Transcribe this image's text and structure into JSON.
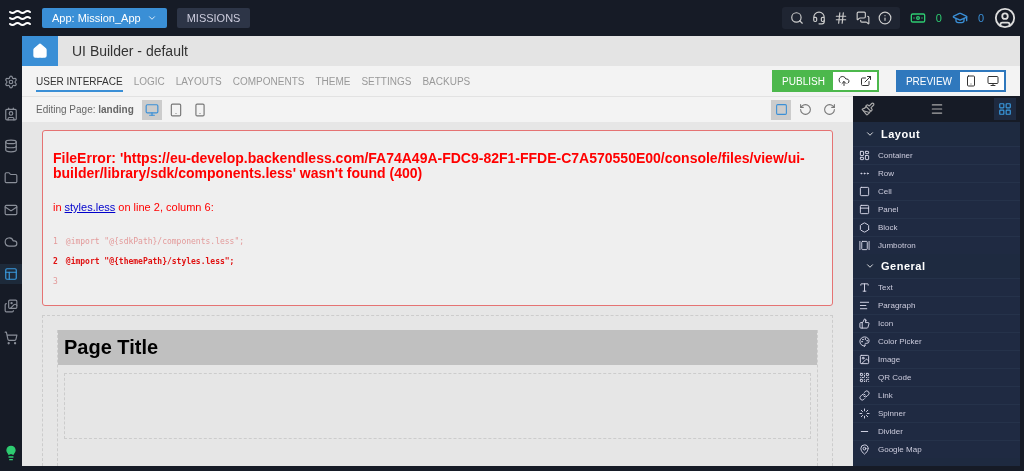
{
  "topbar": {
    "app_button": "App: Mission_App",
    "missions_button": "MISSIONS",
    "money_count": "0",
    "education_count": "0"
  },
  "rail": [
    {
      "kind": "settings",
      "selected": false
    },
    {
      "kind": "users",
      "selected": false
    },
    {
      "kind": "database",
      "selected": false
    },
    {
      "kind": "files",
      "selected": false
    },
    {
      "kind": "messaging",
      "selected": false
    },
    {
      "kind": "cloud",
      "selected": false
    },
    {
      "kind": "ui",
      "selected": true
    },
    {
      "kind": "media",
      "selected": false
    },
    {
      "kind": "market",
      "selected": false
    }
  ],
  "header": {
    "title": "UI Builder - default"
  },
  "tabs": [
    {
      "label": "USER INTERFACE",
      "selected": true
    },
    {
      "label": "LOGIC",
      "selected": false
    },
    {
      "label": "LAYOUTS",
      "selected": false
    },
    {
      "label": "COMPONENTS",
      "selected": false
    },
    {
      "label": "THEME",
      "selected": false
    },
    {
      "label": "SETTINGS",
      "selected": false
    },
    {
      "label": "BACKUPS",
      "selected": false
    }
  ],
  "publish_button": "PUBLISH",
  "preview_button": "PREVIEW",
  "editing": {
    "label": "Editing Page:",
    "page": "landing",
    "devices": [
      {
        "kind": "desktop",
        "selected": true
      },
      {
        "kind": "tablet",
        "selected": false
      },
      {
        "kind": "phone",
        "selected": false
      }
    ],
    "outline_selected": true
  },
  "panel_tabs": [
    {
      "kind": "style",
      "selected": false
    },
    {
      "kind": "tree",
      "selected": false
    },
    {
      "kind": "components",
      "selected": true
    }
  ],
  "sections": [
    {
      "title": "Layout",
      "expanded": true,
      "items": [
        {
          "label": "Container",
          "kind": "container"
        },
        {
          "label": "Row",
          "kind": "row"
        },
        {
          "label": "Cell",
          "kind": "cell"
        },
        {
          "label": "Panel",
          "kind": "panel"
        },
        {
          "label": "Block",
          "kind": "block"
        },
        {
          "label": "Jumbotron",
          "kind": "jumbotron"
        }
      ]
    },
    {
      "title": "General",
      "expanded": true,
      "items": [
        {
          "label": "Text",
          "kind": "text"
        },
        {
          "label": "Paragraph",
          "kind": "paragraph"
        },
        {
          "label": "Icon",
          "kind": "icon"
        },
        {
          "label": "Color Picker",
          "kind": "color"
        },
        {
          "label": "Image",
          "kind": "image"
        },
        {
          "label": "QR Code",
          "kind": "qr"
        },
        {
          "label": "Link",
          "kind": "link"
        },
        {
          "label": "Spinner",
          "kind": "spinner"
        },
        {
          "label": "Divider",
          "kind": "divider"
        },
        {
          "label": "Google Map",
          "kind": "map"
        }
      ]
    }
  ],
  "error": {
    "message": "FileError: 'https://eu-develop.backendless.com/FA74A49A-FDC9-82F1-FFDE-C7A570550E00/console/files/view/ui-builder/library/sdk/components.less' wasn't found (400)",
    "location_prefix": "in",
    "file_link": "styles.less",
    "location_suffix": "on line 2, column 6:",
    "lines": [
      {
        "number": "1",
        "code": "@import \"@{sdkPath}/components.less\";",
        "highlighted": false
      },
      {
        "number": "2",
        "code": "@import \"@{themePath}/styles.less\";",
        "highlighted": true
      },
      {
        "number": "3",
        "highlighted": false
      }
    ]
  },
  "page": {
    "title": "Page Title"
  }
}
